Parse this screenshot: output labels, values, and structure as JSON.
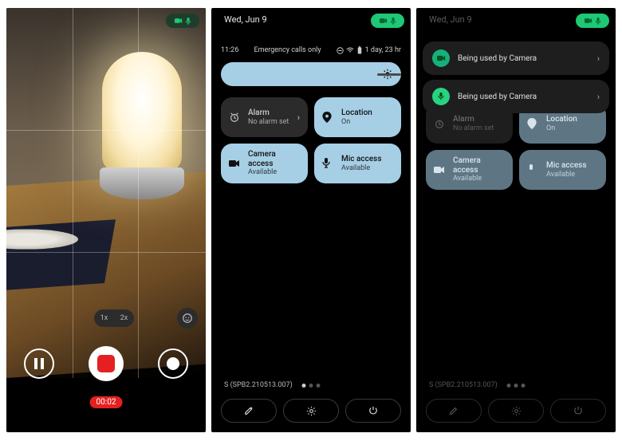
{
  "phone1": {
    "zoom": {
      "x1": "1x",
      "x2": "2x"
    },
    "timer": "00:02"
  },
  "phone2": {
    "date": "Wed, Jun 9",
    "time": "11:26",
    "emergency": "Emergency calls only",
    "battery": "1 day, 23 hr",
    "tiles": {
      "alarm": {
        "title": "Alarm",
        "sub": "No alarm set"
      },
      "location": {
        "title": "Location",
        "sub": "On"
      },
      "camera": {
        "title": "Camera access",
        "sub": "Available"
      },
      "mic": {
        "title": "Mic access",
        "sub": "Available"
      }
    },
    "build": "S (SPB2.210513.007)"
  },
  "phone3": {
    "date": "Wed, Jun 9",
    "notifs": {
      "cam": "Being used by Camera",
      "mic": "Being used by Camera"
    },
    "tiles": {
      "alarm": {
        "title": "Alarm",
        "sub": "No alarm set"
      },
      "location": {
        "title": "Location",
        "sub": "On"
      },
      "camera": {
        "title": "Camera access",
        "sub": "Available"
      },
      "mic": {
        "title": "Mic access",
        "sub": "Available"
      }
    },
    "build": "S (SPB2.210513.007)"
  }
}
